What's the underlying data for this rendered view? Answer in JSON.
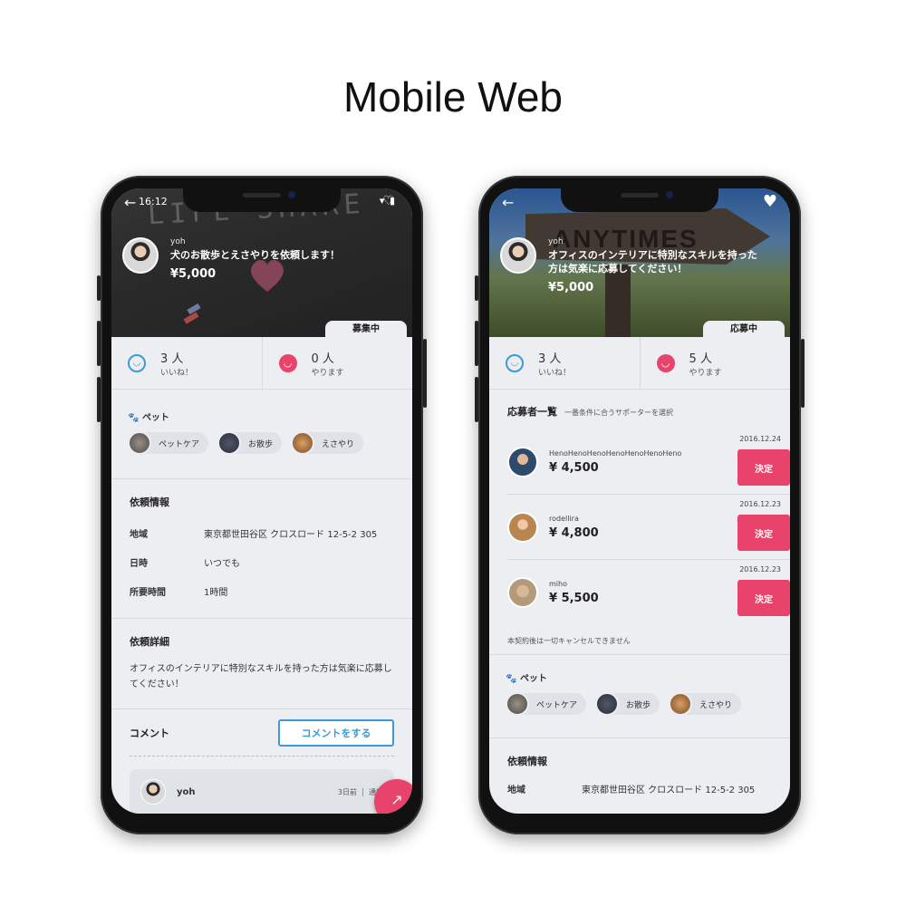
{
  "title": "Mobile Web",
  "colors": {
    "accent_pink": "#e8436a",
    "accent_blue": "#3d9ad6",
    "screen_bg": "#eceef1"
  },
  "left": {
    "status": {
      "time": "16:12",
      "signal": "wifi-battery"
    },
    "hero_chalk_text": "LIFE SHARE",
    "author": {
      "name": "yoh",
      "title": "犬のお散歩とえさやりを依頼します！",
      "price": "¥5,000"
    },
    "badge": "募集中",
    "counters": [
      {
        "num": "3 人",
        "label": "いいね！",
        "icon": "smile-icon"
      },
      {
        "num": "0 人",
        "label": "やります",
        "icon": "happy-face-icon"
      }
    ],
    "pet": {
      "heading": "ペット",
      "chips": [
        "ペットケア",
        "お散歩",
        "えさやり"
      ]
    },
    "info": {
      "heading": "依頼情報",
      "rows": [
        {
          "k": "地域",
          "v": "東京都世田谷区 クロスロード 12-5-2 305"
        },
        {
          "k": "日時",
          "v": "いつでも"
        },
        {
          "k": "所要時間",
          "v": "1時間"
        }
      ]
    },
    "detail": {
      "heading": "依頼詳細",
      "text": "オフィスのインテリアに特別なスキルを持った方は気楽に応募してください！"
    },
    "comment": {
      "heading": "コメント",
      "button": "コメントをする",
      "card": {
        "name": "yoh",
        "time": "3日前",
        "report": "通報"
      }
    }
  },
  "right": {
    "hero_sign_text": "ANYTIMES",
    "author": {
      "name": "yoh",
      "title": "オフィスのインテリアに特別なスキルを持った方は気楽に応募してください！",
      "price": "¥5,000"
    },
    "badge": "応募中",
    "counters": [
      {
        "num": "3 人",
        "label": "いいね！",
        "icon": "smile-icon"
      },
      {
        "num": "5 人",
        "label": "やります",
        "icon": "happy-face-icon"
      }
    ],
    "applicants": {
      "heading": "応募者一覧",
      "sub": "一番条件に合うサポーターを選択",
      "items": [
        {
          "name": "HenoHenoHenoHenoHenoHenoHeno",
          "price": "¥ 4,500",
          "date": "2016.12.24",
          "button": "決定"
        },
        {
          "name": "rodellira",
          "price": "¥ 4,800",
          "date": "2016.12.23",
          "button": "決定"
        },
        {
          "name": "miho",
          "price": "¥ 5,500",
          "date": "2016.12.23",
          "button": "決定"
        }
      ],
      "note": "本契約後は一切キャンセルできません"
    },
    "pet": {
      "heading": "ペット",
      "chips": [
        "ペットケア",
        "お散歩",
        "えさやり"
      ]
    },
    "info": {
      "heading": "依頼情報",
      "rows": [
        {
          "k": "地域",
          "v": "東京都世田谷区 クロスロード 12-5-2 305"
        }
      ]
    }
  }
}
